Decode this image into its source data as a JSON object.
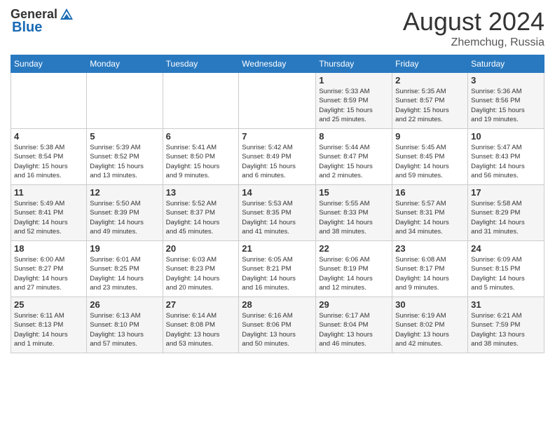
{
  "header": {
    "logo_general": "General",
    "logo_blue": "Blue",
    "month_year": "August 2024",
    "location": "Zhemchug, Russia"
  },
  "columns": [
    "Sunday",
    "Monday",
    "Tuesday",
    "Wednesday",
    "Thursday",
    "Friday",
    "Saturday"
  ],
  "weeks": [
    [
      {
        "day": "",
        "info": ""
      },
      {
        "day": "",
        "info": ""
      },
      {
        "day": "",
        "info": ""
      },
      {
        "day": "",
        "info": ""
      },
      {
        "day": "1",
        "info": "Sunrise: 5:33 AM\nSunset: 8:59 PM\nDaylight: 15 hours\nand 25 minutes."
      },
      {
        "day": "2",
        "info": "Sunrise: 5:35 AM\nSunset: 8:57 PM\nDaylight: 15 hours\nand 22 minutes."
      },
      {
        "day": "3",
        "info": "Sunrise: 5:36 AM\nSunset: 8:56 PM\nDaylight: 15 hours\nand 19 minutes."
      }
    ],
    [
      {
        "day": "4",
        "info": "Sunrise: 5:38 AM\nSunset: 8:54 PM\nDaylight: 15 hours\nand 16 minutes."
      },
      {
        "day": "5",
        "info": "Sunrise: 5:39 AM\nSunset: 8:52 PM\nDaylight: 15 hours\nand 13 minutes."
      },
      {
        "day": "6",
        "info": "Sunrise: 5:41 AM\nSunset: 8:50 PM\nDaylight: 15 hours\nand 9 minutes."
      },
      {
        "day": "7",
        "info": "Sunrise: 5:42 AM\nSunset: 8:49 PM\nDaylight: 15 hours\nand 6 minutes."
      },
      {
        "day": "8",
        "info": "Sunrise: 5:44 AM\nSunset: 8:47 PM\nDaylight: 15 hours\nand 2 minutes."
      },
      {
        "day": "9",
        "info": "Sunrise: 5:45 AM\nSunset: 8:45 PM\nDaylight: 14 hours\nand 59 minutes."
      },
      {
        "day": "10",
        "info": "Sunrise: 5:47 AM\nSunset: 8:43 PM\nDaylight: 14 hours\nand 56 minutes."
      }
    ],
    [
      {
        "day": "11",
        "info": "Sunrise: 5:49 AM\nSunset: 8:41 PM\nDaylight: 14 hours\nand 52 minutes."
      },
      {
        "day": "12",
        "info": "Sunrise: 5:50 AM\nSunset: 8:39 PM\nDaylight: 14 hours\nand 49 minutes."
      },
      {
        "day": "13",
        "info": "Sunrise: 5:52 AM\nSunset: 8:37 PM\nDaylight: 14 hours\nand 45 minutes."
      },
      {
        "day": "14",
        "info": "Sunrise: 5:53 AM\nSunset: 8:35 PM\nDaylight: 14 hours\nand 41 minutes."
      },
      {
        "day": "15",
        "info": "Sunrise: 5:55 AM\nSunset: 8:33 PM\nDaylight: 14 hours\nand 38 minutes."
      },
      {
        "day": "16",
        "info": "Sunrise: 5:57 AM\nSunset: 8:31 PM\nDaylight: 14 hours\nand 34 minutes."
      },
      {
        "day": "17",
        "info": "Sunrise: 5:58 AM\nSunset: 8:29 PM\nDaylight: 14 hours\nand 31 minutes."
      }
    ],
    [
      {
        "day": "18",
        "info": "Sunrise: 6:00 AM\nSunset: 8:27 PM\nDaylight: 14 hours\nand 27 minutes."
      },
      {
        "day": "19",
        "info": "Sunrise: 6:01 AM\nSunset: 8:25 PM\nDaylight: 14 hours\nand 23 minutes."
      },
      {
        "day": "20",
        "info": "Sunrise: 6:03 AM\nSunset: 8:23 PM\nDaylight: 14 hours\nand 20 minutes."
      },
      {
        "day": "21",
        "info": "Sunrise: 6:05 AM\nSunset: 8:21 PM\nDaylight: 14 hours\nand 16 minutes."
      },
      {
        "day": "22",
        "info": "Sunrise: 6:06 AM\nSunset: 8:19 PM\nDaylight: 14 hours\nand 12 minutes."
      },
      {
        "day": "23",
        "info": "Sunrise: 6:08 AM\nSunset: 8:17 PM\nDaylight: 14 hours\nand 9 minutes."
      },
      {
        "day": "24",
        "info": "Sunrise: 6:09 AM\nSunset: 8:15 PM\nDaylight: 14 hours\nand 5 minutes."
      }
    ],
    [
      {
        "day": "25",
        "info": "Sunrise: 6:11 AM\nSunset: 8:13 PM\nDaylight: 14 hours\nand 1 minute."
      },
      {
        "day": "26",
        "info": "Sunrise: 6:13 AM\nSunset: 8:10 PM\nDaylight: 13 hours\nand 57 minutes."
      },
      {
        "day": "27",
        "info": "Sunrise: 6:14 AM\nSunset: 8:08 PM\nDaylight: 13 hours\nand 53 minutes."
      },
      {
        "day": "28",
        "info": "Sunrise: 6:16 AM\nSunset: 8:06 PM\nDaylight: 13 hours\nand 50 minutes."
      },
      {
        "day": "29",
        "info": "Sunrise: 6:17 AM\nSunset: 8:04 PM\nDaylight: 13 hours\nand 46 minutes."
      },
      {
        "day": "30",
        "info": "Sunrise: 6:19 AM\nSunset: 8:02 PM\nDaylight: 13 hours\nand 42 minutes."
      },
      {
        "day": "31",
        "info": "Sunrise: 6:21 AM\nSunset: 7:59 PM\nDaylight: 13 hours\nand 38 minutes."
      }
    ]
  ]
}
